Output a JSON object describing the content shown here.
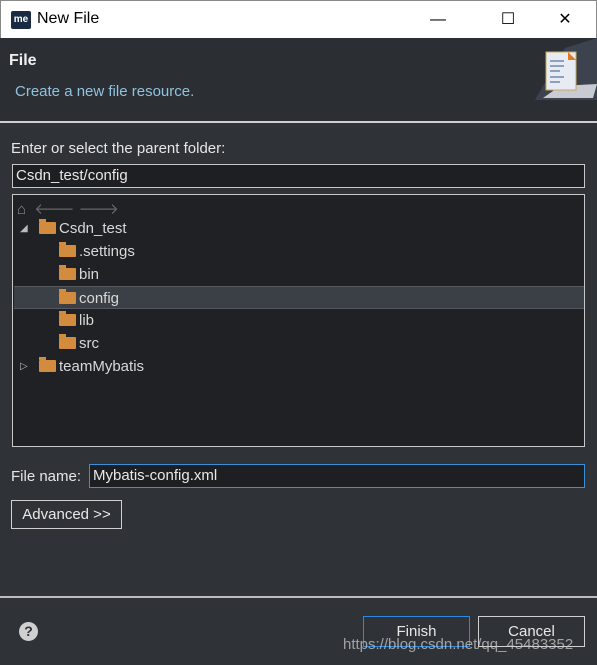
{
  "window": {
    "title": "New File",
    "app_icon": "me",
    "minimize": "—",
    "maximize": "☐",
    "close": "✕"
  },
  "header": {
    "title": "File",
    "description": "Create a new file resource.",
    "banner_icon": "new-file-wizard-icon"
  },
  "folder": {
    "label": "Enter or select the parent folder:",
    "value": "Csdn_test/config"
  },
  "tree": {
    "nav_icons": [
      "home-icon",
      "back-arrow-icon",
      "forward-arrow-icon"
    ],
    "items": [
      {
        "label": "Csdn_test",
        "level": 0,
        "expanded": true
      },
      {
        "label": ".settings",
        "level": 1
      },
      {
        "label": "bin",
        "level": 1
      },
      {
        "label": "config",
        "level": 1,
        "selected": true
      },
      {
        "label": "lib",
        "level": 1
      },
      {
        "label": "src",
        "level": 1
      },
      {
        "label": "teamMybatis",
        "level": 0,
        "expanded": false
      }
    ]
  },
  "file_name": {
    "label": "File name:",
    "value": "Mybatis-config.xml"
  },
  "advanced_label": "Advanced >>",
  "footer": {
    "help": "?",
    "finish": "Finish",
    "cancel": "Cancel"
  },
  "watermark": "https://blog.csdn.net/qq_45483352"
}
